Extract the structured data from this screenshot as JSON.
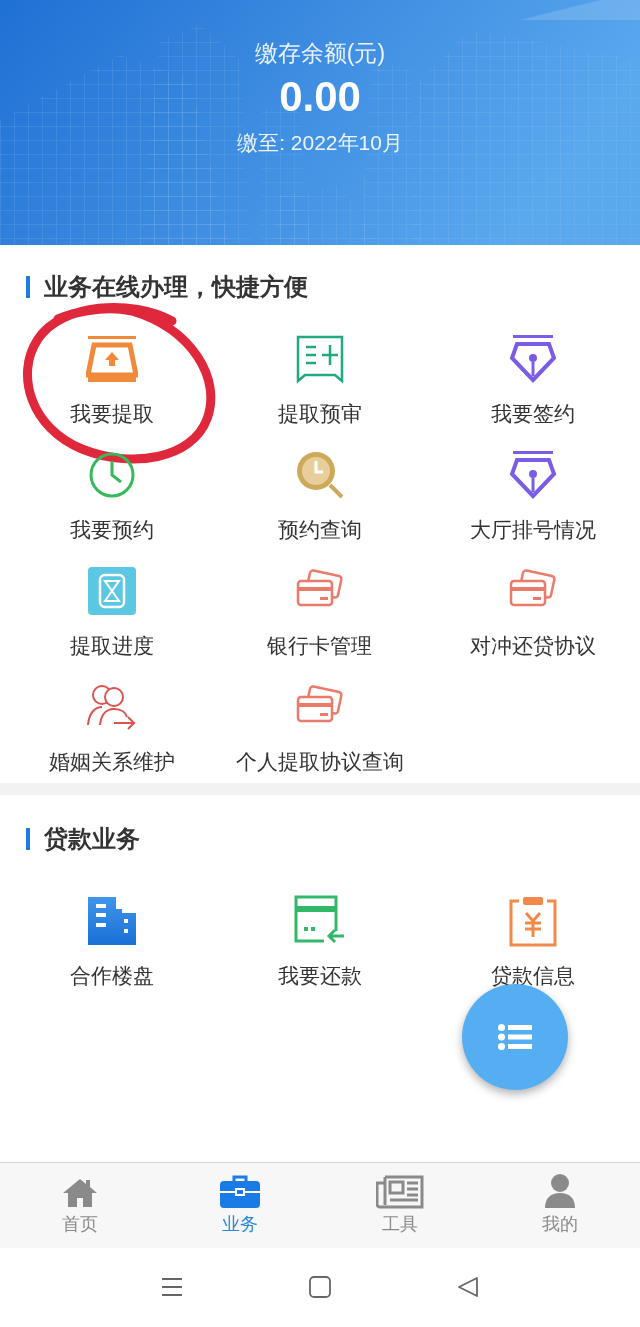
{
  "header": {
    "kind": "picture",
    "balance_label": "缴存余额(元)",
    "balance": "0.00",
    "paid_until": "缴至: 2022年10月"
  },
  "sections": [
    {
      "title": "业务在线办理，快捷方便",
      "items": [
        {
          "label": "我要提取",
          "kind": "tray",
          "circled": true
        },
        {
          "label": "提取预审",
          "kind": "form",
          "circled": false
        },
        {
          "label": "我要签约",
          "kind": "pen",
          "circled": false
        },
        {
          "label": "我要预约",
          "kind": "clock",
          "circled": false
        },
        {
          "label": "预约查询",
          "kind": "search-clock",
          "circled": false
        },
        {
          "label": "大厅排号情况",
          "kind": "pen",
          "circled": false
        },
        {
          "label": "提取进度",
          "kind": "hourglass",
          "circled": false
        },
        {
          "label": "银行卡管理",
          "kind": "card",
          "circled": false
        },
        {
          "label": "对冲还贷协议",
          "kind": "card",
          "circled": false
        },
        {
          "label": "婚姻关系维护",
          "kind": "people",
          "circled": false
        },
        {
          "label": "个人提取协议查询",
          "kind": "card",
          "circled": false
        }
      ]
    },
    {
      "title": "贷款业务",
      "items": [
        {
          "label": "合作楼盘",
          "kind": "building",
          "circled": false
        },
        {
          "label": "我要还款",
          "kind": "repay",
          "circled": false
        },
        {
          "label": "贷款信息",
          "kind": "invoice",
          "circled": false
        }
      ]
    }
  ],
  "tab_bar": [
    {
      "label": "首页",
      "kind": "home",
      "selected": false
    },
    {
      "label": "业务",
      "kind": "briefcase",
      "selected": true
    },
    {
      "label": "工具",
      "kind": "news",
      "selected": false
    },
    {
      "label": "我的",
      "kind": "user",
      "selected": false
    }
  ]
}
